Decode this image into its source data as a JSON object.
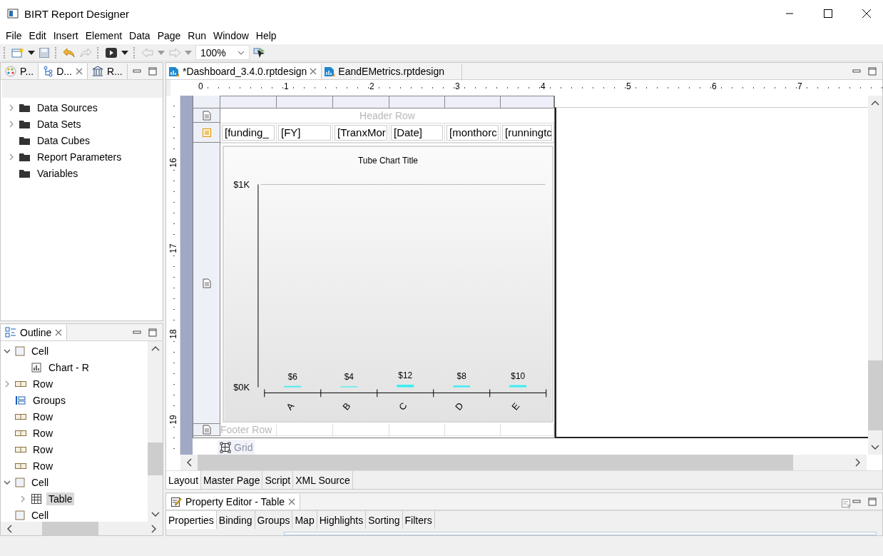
{
  "window": {
    "title": "BIRT Report Designer"
  },
  "menu": [
    "File",
    "Edit",
    "Insert",
    "Element",
    "Data",
    "Page",
    "Run",
    "Window",
    "Help"
  ],
  "toolbar": {
    "zoom": "100%"
  },
  "explorer": {
    "tabs": [
      {
        "label": "P...",
        "selected": false,
        "kind": "palette"
      },
      {
        "label": "D...",
        "selected": true,
        "kind": "data"
      },
      {
        "label": "R...",
        "selected": false,
        "kind": "resource"
      }
    ],
    "items": [
      {
        "label": "Data Sources",
        "expandable": true
      },
      {
        "label": "Data Sets",
        "expandable": true
      },
      {
        "label": "Data Cubes",
        "expandable": false
      },
      {
        "label": "Report Parameters",
        "expandable": true
      },
      {
        "label": "Variables",
        "expandable": false
      }
    ]
  },
  "outline": {
    "title": "Outline",
    "items": [
      {
        "label": "Cell",
        "kind": "cell",
        "selected": false,
        "expanded": true,
        "children": [
          {
            "label": "Chart - R",
            "kind": "chart",
            "selected": false
          }
        ]
      },
      {
        "label": "Row",
        "kind": "row",
        "selected": false,
        "expanded": false
      },
      {
        "label": "Groups",
        "kind": "groups",
        "selected": false
      },
      {
        "label": "Row",
        "kind": "row",
        "selected": false
      },
      {
        "label": "Row",
        "kind": "row",
        "selected": false
      },
      {
        "label": "Row",
        "kind": "row",
        "selected": false
      },
      {
        "label": "Row",
        "kind": "row",
        "selected": false
      },
      {
        "label": "Cell",
        "kind": "cell",
        "selected": false,
        "expanded": true,
        "children": [
          {
            "label": "Table",
            "kind": "table",
            "selected": true,
            "expanded": false
          }
        ]
      },
      {
        "label": "Cell",
        "kind": "cell",
        "selected": false
      }
    ]
  },
  "editor": {
    "tabs": [
      {
        "label": "*Dashboard_3.4.0.rptdesign",
        "selected": true
      },
      {
        "label": "EandEMetrics.rptdesign",
        "selected": false
      }
    ],
    "ruler": {
      "horizontal": [
        "0",
        "1",
        "2",
        "3",
        "4",
        "5",
        "6",
        "7"
      ],
      "vertical": [
        "16",
        "17",
        "18",
        "19"
      ]
    },
    "header_row": "Header Row",
    "detail_cells": [
      "[funding_",
      "[FY]",
      "[TranxMor",
      "[Date]",
      "[monthorc",
      "[runningtc"
    ],
    "chart": {
      "chart_data": {
        "type": "bar",
        "title": "Tube Chart Title",
        "categories": [
          "A",
          "B",
          "C",
          "D",
          "E"
        ],
        "series": [
          {
            "color": "#33eef5",
            "values": [
              6,
              4,
              12,
              8,
              10
            ]
          }
        ],
        "ylim": [
          0,
          1000
        ],
        "yticks": [
          {
            "value": 0,
            "label": "$0K"
          },
          {
            "value": 1000,
            "label": "$1K"
          }
        ],
        "value_labels": [
          "$6",
          "$4",
          "$12",
          "$8",
          "$10"
        ]
      }
    },
    "footer_row": "Footer Row",
    "grid_label": "Grid",
    "view_tabs": [
      {
        "label": "Layout",
        "selected": true
      },
      {
        "label": "Master Page",
        "selected": false
      },
      {
        "label": "Script",
        "selected": false
      },
      {
        "label": "XML Source",
        "selected": false
      }
    ]
  },
  "property_editor": {
    "title": "Property Editor - Table",
    "tabs": [
      {
        "label": "Properties",
        "selected": true
      },
      {
        "label": "Binding",
        "selected": false
      },
      {
        "label": "Groups",
        "selected": false
      },
      {
        "label": "Map",
        "selected": false
      },
      {
        "label": "Highlights",
        "selected": false
      },
      {
        "label": "Sorting",
        "selected": false
      },
      {
        "label": "Filters",
        "selected": false
      }
    ]
  }
}
